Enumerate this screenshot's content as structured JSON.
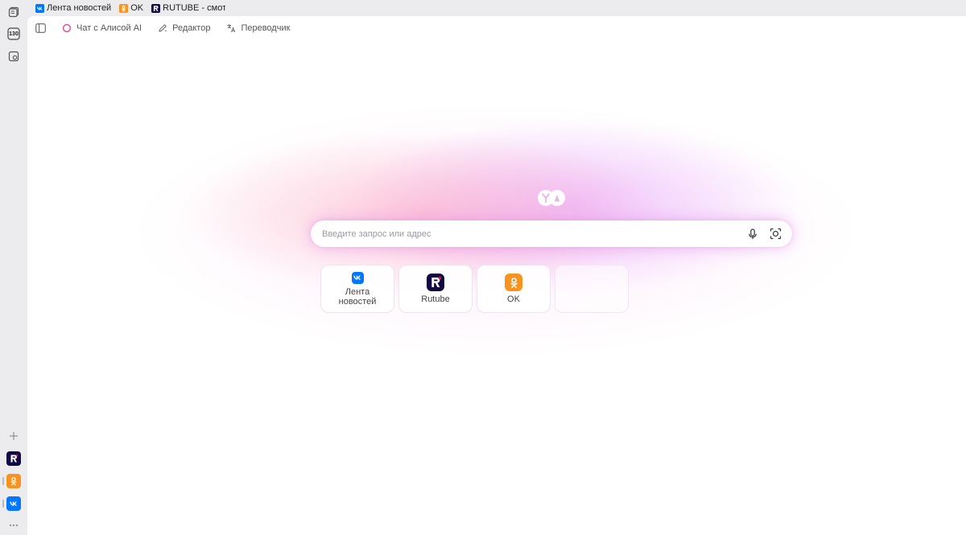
{
  "bookmarks": [
    {
      "label": "Лента новостей",
      "icon": "vk-icon"
    },
    {
      "label": "OK",
      "icon": "ok-icon"
    },
    {
      "label": "RUTUBE - смотре",
      "icon": "rutube-icon"
    }
  ],
  "sidebar": {
    "tab_count": "130",
    "apps": [
      "rutube-icon",
      "ok-icon",
      "vk-icon"
    ]
  },
  "topbar": {
    "items": [
      {
        "label": "Чат с Алисой AI",
        "icon": "alice-icon"
      },
      {
        "label": "Редактор",
        "icon": "pen-icon"
      },
      {
        "label": "Переводчик",
        "icon": "translate-icon"
      }
    ]
  },
  "search": {
    "placeholder": "Введите запрос или адрес"
  },
  "tiles": [
    {
      "label": "Лента\nновостей",
      "icon": "vk-icon"
    },
    {
      "label": "Rutube",
      "icon": "rutube-icon"
    },
    {
      "label": "OK",
      "icon": "ok-icon"
    },
    {
      "label": "",
      "icon": ""
    }
  ],
  "colors": {
    "vk": "#0077ff",
    "ok": "#f7931e",
    "rutube_bg": "#100943",
    "rutube_accent": "#ed143b",
    "glow_pink": "#ff96aa",
    "glow_violet": "#da78ff"
  }
}
